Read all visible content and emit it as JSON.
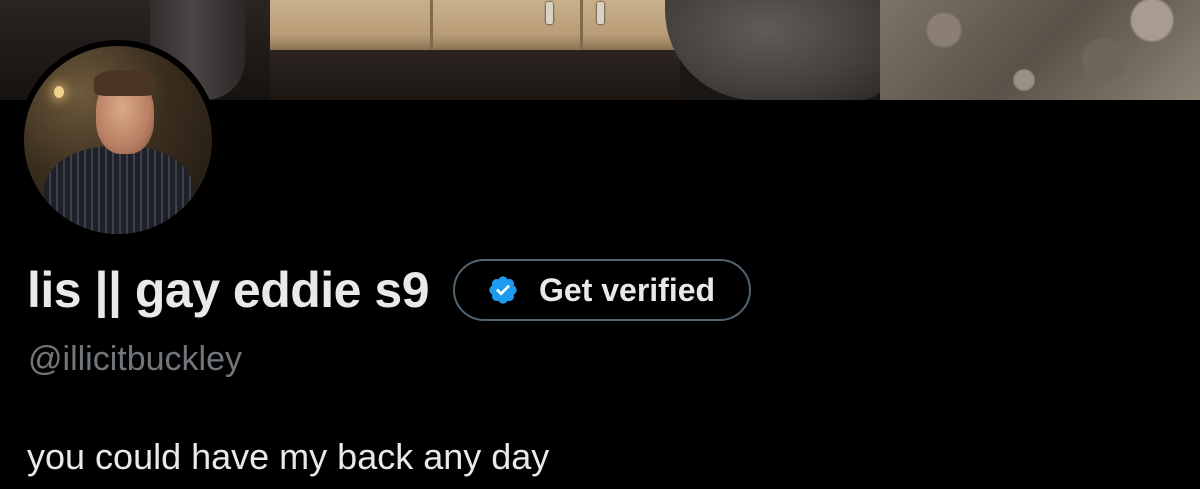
{
  "profile": {
    "display_name": "lis || gay eddie s9",
    "handle": "@illicitbuckley",
    "bio": "you could have my back any day"
  },
  "verify_button": {
    "label": "Get verified",
    "icon": "verified-badge-icon",
    "badge_color": "#1d9bf0"
  },
  "colors": {
    "background": "#000000",
    "primary_text": "#e7e9ea",
    "secondary_text": "#71767b",
    "button_border": "#536471"
  }
}
